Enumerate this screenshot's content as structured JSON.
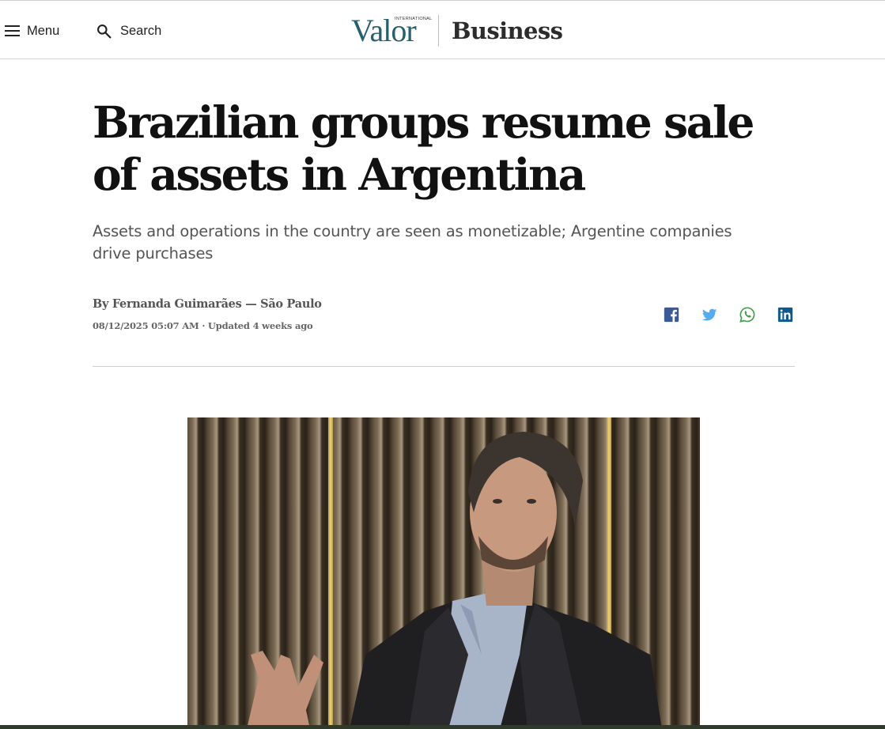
{
  "header": {
    "menu_label": "Menu",
    "search_label": "Search",
    "brand_intl": "INTERNATIONAL",
    "brand_name": "Valor",
    "section": "Business"
  },
  "article": {
    "title": "Brazilian groups resume sale of assets in Argentina",
    "subtitle": "Assets and operations in the country are seen as monetizable; Argentine companies drive purchases",
    "byline": "By Fernanda Guimarães — São Paulo",
    "dateline": "08/12/2025 05:07 AM · Updated 4 weeks ago"
  },
  "share": [
    {
      "name": "facebook-icon",
      "color": "#3b5998"
    },
    {
      "name": "twitter-icon",
      "color": "#55acee"
    },
    {
      "name": "whatsapp-icon",
      "color": "#43a047"
    },
    {
      "name": "linkedin-icon",
      "color": "#0e5a8a"
    }
  ],
  "colors": {
    "brand_teal": "#26606d",
    "title": "#111111",
    "subtitle": "#555555"
  }
}
